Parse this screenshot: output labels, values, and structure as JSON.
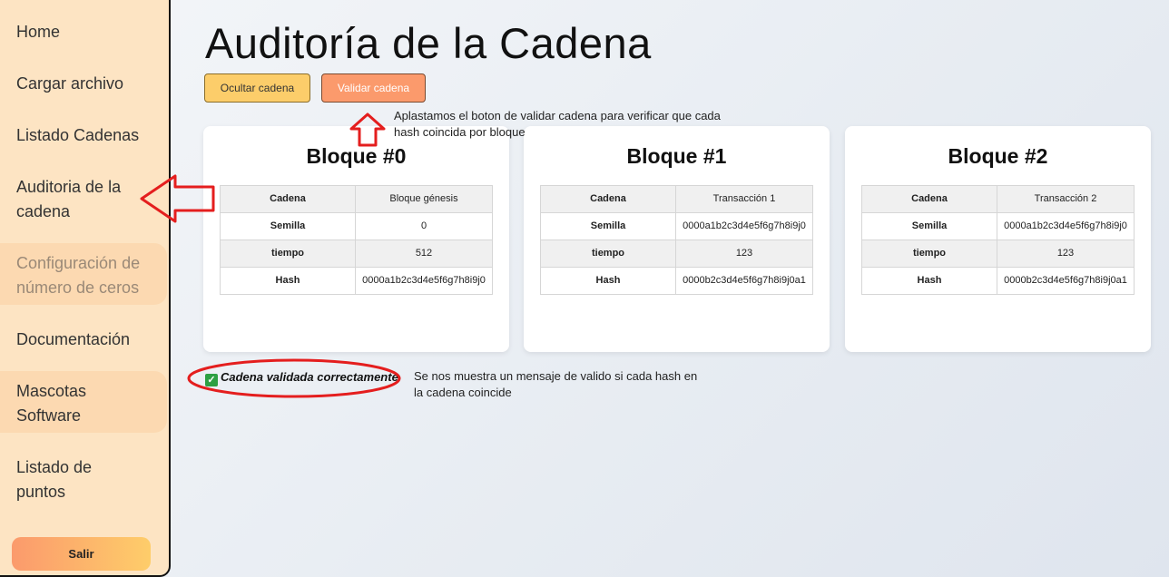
{
  "sidebar": {
    "items": [
      {
        "label": "Home"
      },
      {
        "label": "Cargar archivo"
      },
      {
        "label": "Listado Cadenas"
      },
      {
        "label": "Auditoria de la cadena"
      },
      {
        "label": "Configuración de número de ceros"
      },
      {
        "label": "Documentación"
      },
      {
        "label": "Mascotas Software"
      },
      {
        "label": "Listado de puntos"
      }
    ],
    "logout_label": "Salir"
  },
  "main": {
    "title": "Auditoría de la Cadena",
    "hide_button": "Ocultar cadena",
    "validate_button": "Validar cadena",
    "blocks": [
      {
        "title": "Bloque #0",
        "rows": [
          {
            "key": "Cadena",
            "value": "Bloque génesis"
          },
          {
            "key": "Semilla",
            "value": "0"
          },
          {
            "key": "tiempo",
            "value": "512"
          },
          {
            "key": "Hash",
            "value": "0000a1b2c3d4e5f6g7h8i9j0"
          }
        ]
      },
      {
        "title": "Bloque #1",
        "rows": [
          {
            "key": "Cadena",
            "value": "Transacción 1"
          },
          {
            "key": "Semilla",
            "value": "0000a1b2c3d4e5f6g7h8i9j0"
          },
          {
            "key": "tiempo",
            "value": "123"
          },
          {
            "key": "Hash",
            "value": "0000b2c3d4e5f6g7h8i9j0a1"
          }
        ]
      },
      {
        "title": "Bloque #2",
        "rows": [
          {
            "key": "Cadena",
            "value": "Transacción 2"
          },
          {
            "key": "Semilla",
            "value": "0000a1b2c3d4e5f6g7h8i9j0"
          },
          {
            "key": "tiempo",
            "value": "123"
          },
          {
            "key": "Hash",
            "value": "0000b2c3d4e5f6g7h8i9j0a1"
          }
        ]
      }
    ],
    "status_message": "Cadena validada correctamente"
  },
  "annotations": {
    "validate_note": "Aplastamos el boton de validar cadena para verificar que cada hash coincida por bloque",
    "result_note": "Se nos muestra un mensaje de valido si cada hash en la cadena coincide"
  },
  "colors": {
    "sidebar_bg": "#fde4c3",
    "hide_button": "#fccd6a",
    "validate_button": "#fb9a6c",
    "annotation_red": "#e41e1e",
    "success_green": "#2ea043"
  }
}
